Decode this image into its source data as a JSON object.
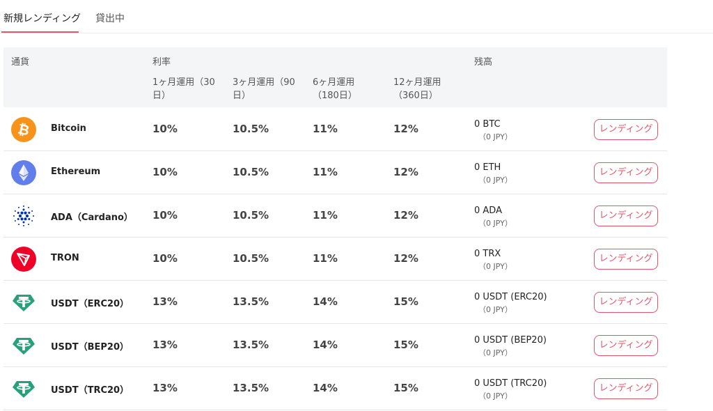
{
  "tabs": [
    {
      "label": "新規レンディング",
      "active": true
    },
    {
      "label": "貸出中",
      "active": false
    }
  ],
  "header": {
    "currency": "通貨",
    "rate": "利率",
    "balance": "残高",
    "periods": [
      {
        "line1": "1ヶ月運用（30",
        "line2": "日）"
      },
      {
        "line1": "3ヶ月運用（90",
        "line2": "日）"
      },
      {
        "line1": "6ヶ月運用",
        "line2": "（180日）"
      },
      {
        "line1": "12ヶ月運用",
        "line2": "（360日）"
      }
    ]
  },
  "rows": [
    {
      "name": "Bitcoin",
      "icon": "bitcoin-icon",
      "color": "#f7931a",
      "rates": [
        "10%",
        "10.5%",
        "11%",
        "12%"
      ],
      "balance": "0 BTC",
      "jpy": "（0 JPY）",
      "button": "レンディング"
    },
    {
      "name": "Ethereum",
      "icon": "ethereum-icon",
      "color": "#627eea",
      "rates": [
        "10%",
        "10.5%",
        "11%",
        "12%"
      ],
      "balance": "0 ETH",
      "jpy": "（0 JPY）",
      "button": "レンディング"
    },
    {
      "name": "ADA（Cardano）",
      "icon": "cardano-icon",
      "color": "#0033ad",
      "rates": [
        "10%",
        "10.5%",
        "11%",
        "12%"
      ],
      "balance": "0 ADA",
      "jpy": "（0 JPY）",
      "button": "レンディング"
    },
    {
      "name": "TRON",
      "icon": "tron-icon",
      "color": "#ef0027",
      "rates": [
        "10%",
        "10.5%",
        "11%",
        "12%"
      ],
      "balance": "0 TRX",
      "jpy": "（0 JPY）",
      "button": "レンディング"
    },
    {
      "name": "USDT（ERC20）",
      "icon": "tether-icon",
      "color": "#26a17b",
      "rates": [
        "13%",
        "13.5%",
        "14%",
        "15%"
      ],
      "balance": "0 USDT (ERC20)",
      "jpy": "（0 JPY）",
      "button": "レンディング"
    },
    {
      "name": "USDT（BEP20）",
      "icon": "tether-icon",
      "color": "#26a17b",
      "rates": [
        "13%",
        "13.5%",
        "14%",
        "15%"
      ],
      "balance": "0 USDT (BEP20)",
      "jpy": "（0 JPY）",
      "button": "レンディング"
    },
    {
      "name": "USDT（TRC20）",
      "icon": "tether-icon",
      "color": "#26a17b",
      "rates": [
        "13%",
        "13.5%",
        "14%",
        "15%"
      ],
      "balance": "0 USDT (TRC20)",
      "jpy": "（0 JPY）",
      "button": "レンディング"
    }
  ],
  "accent_color": "#e0566a"
}
